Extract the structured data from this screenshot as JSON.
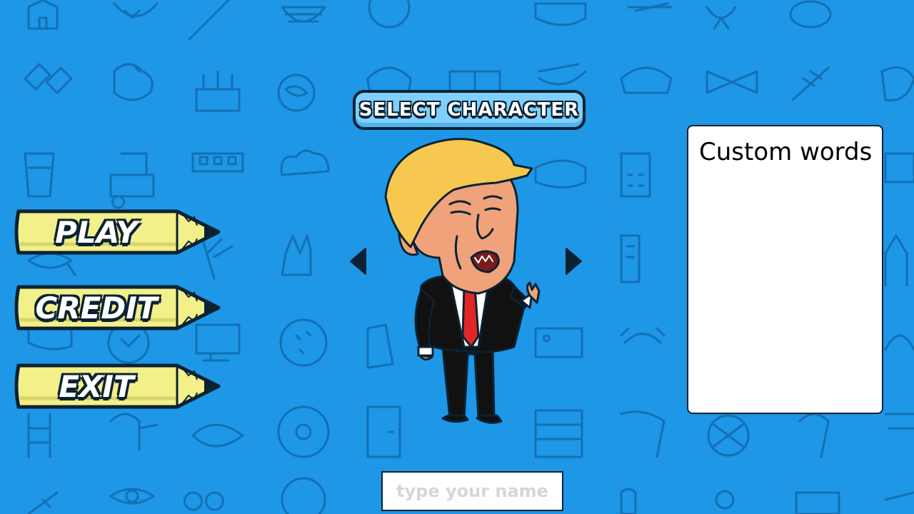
{
  "menu": {
    "title": "SELECT CHARACTER",
    "buttons": [
      {
        "label": "PLAY"
      },
      {
        "label": "CREDIT"
      },
      {
        "label": "EXIT"
      }
    ]
  },
  "character_selector": {
    "prev_icon": "triangle-left",
    "next_icon": "triangle-right"
  },
  "custom_words": {
    "title": "Custom words",
    "content": ""
  },
  "name_field": {
    "placeholder": "type your name",
    "value": ""
  },
  "colors": {
    "background": "#1d97e6",
    "doodle": "#1466a8",
    "pencil_body": "#f3f08a",
    "outline": "#0b2233"
  }
}
